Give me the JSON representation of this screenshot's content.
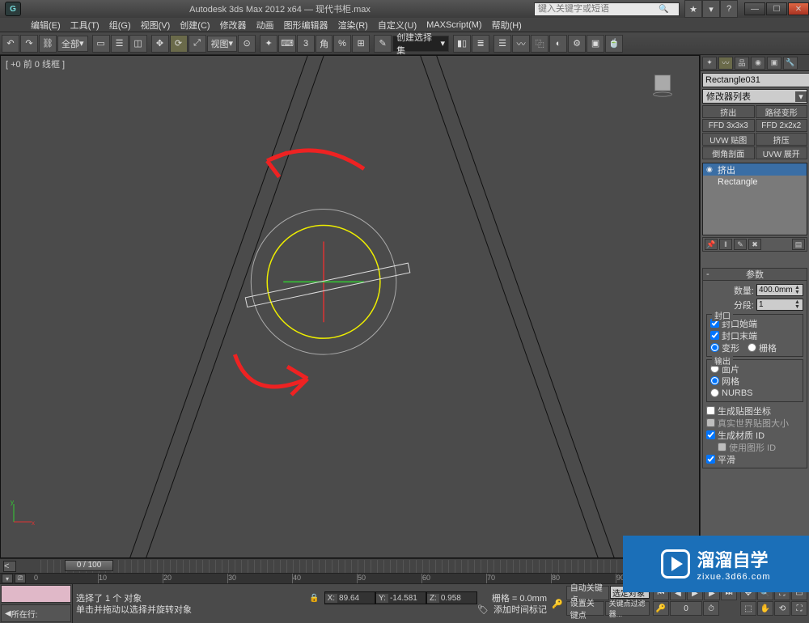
{
  "window": {
    "app_title": "Autodesk 3ds Max  2012 x64 — 现代书柜.max",
    "search_placeholder": "键入关键字或短语"
  },
  "menu": [
    "编辑(E)",
    "工具(T)",
    "组(G)",
    "视图(V)",
    "创建(C)",
    "修改器",
    "动画",
    "图形编辑器",
    "渲染(R)",
    "自定义(U)",
    "MAXScript(M)",
    "帮助(H)"
  ],
  "toolbar": {
    "selection_set_label": "全部",
    "view_label": "视图",
    "angle_label": "角",
    "named_set": "创建选择集"
  },
  "viewport": {
    "label": "[ +0 前 0 线框 ]"
  },
  "command_panel": {
    "object_name": "Rectangle031",
    "modifier_list_label": "修改器列表",
    "mod_buttons": [
      "挤出",
      "路径变形",
      "FFD 3x3x3",
      "FFD 2x2x2",
      "UVW 贴图",
      "挤压",
      "倒角剖面",
      "UVW 展开"
    ],
    "stack": [
      {
        "icon": "◉",
        "label": "挤出",
        "sel": true
      },
      {
        "icon": "",
        "label": "Rectangle",
        "sel": false
      }
    ]
  },
  "params": {
    "rollout_title": "参数",
    "amount_label": "数量:",
    "amount_value": "400.0mm",
    "segments_label": "分段:",
    "segments_value": "1",
    "cap_group": "封口",
    "cap_start": "封口始端",
    "cap_end": "封口末端",
    "morph_label": "变形",
    "grid_label": "栅格",
    "output_group": "输出",
    "patch": "面片",
    "mesh": "网格",
    "nurbs": "NURBS",
    "gen_map": "生成贴图坐标",
    "real_world": "真实世界贴图大小",
    "gen_mat_id": "生成材质 ID",
    "use_shape_id": "使用图形 ID",
    "smooth": "平滑"
  },
  "timeline": {
    "slider": "0 / 100",
    "ticks": [
      "0",
      "10",
      "20",
      "30",
      "40",
      "50",
      "60",
      "70",
      "80",
      "90"
    ]
  },
  "status": {
    "now_btn": "所在行:",
    "line1": "选择了 1 个 对象",
    "line2": "单击并拖动以选择并旋转对象",
    "x": "89.64",
    "y": "-14.581",
    "z": "0.958",
    "grid": "栅格 = 0.0mm",
    "add_time_tag": "添加时间标记",
    "auto_key": "自动关键点",
    "sel_filter": "选定对象",
    "set_key": "设置关键点",
    "key_filter": "关键点过滤器..."
  },
  "watermark": {
    "brand": "溜溜自学",
    "url": "zixue.3d66.com"
  }
}
